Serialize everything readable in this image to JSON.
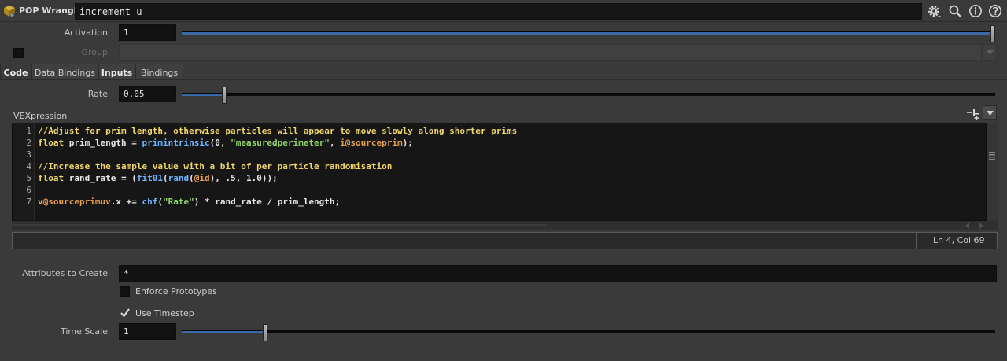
{
  "header": {
    "node_type": "POP Wrangle",
    "node_name": "increment_u",
    "icons": [
      "node-type-icon",
      "gear-icon",
      "search-icon",
      "info-icon",
      "help-icon"
    ]
  },
  "activation": {
    "label": "Activation",
    "value": "1",
    "slider_fraction": 1.0
  },
  "group": {
    "label": "Group",
    "value": ""
  },
  "tabs": [
    {
      "label": "Code"
    },
    {
      "label": "Data Bindings"
    },
    {
      "label": "Inputs"
    },
    {
      "label": "Bindings"
    }
  ],
  "rate": {
    "label": "Rate",
    "value": "0.05",
    "slider_fraction": 0.05
  },
  "vexpression": {
    "label": "VEXpression",
    "line_numbers": [
      "1",
      "2",
      "3",
      "4",
      "5",
      "6",
      "7"
    ],
    "lines": [
      "//Adjust for prim length, otherwise particles will appear to move slowly along shorter prims",
      "float prim_length = primintrinsic(0, \"measuredperimeter\", i@sourceprim);",
      "",
      "//Increase the sample value with a bit of per particle randomisation",
      "float rand_rate = (fit01(rand(@id), .5, 1.0));",
      "",
      "v@sourceprimuv.x += chf(\"Rate\") * rand_rate / prim_length;"
    ],
    "status": "Ln 4, Col 69"
  },
  "attributes": {
    "label": "Attributes to Create",
    "value": "*",
    "enforce_prototypes_label": "Enforce Prototypes",
    "enforce_prototypes_checked": false,
    "use_timestep_label": "Use Timestep",
    "use_timestep_checked": true
  },
  "time_scale": {
    "label": "Time Scale",
    "value": "1",
    "slider_fraction": 0.1
  },
  "colors": {
    "background": "#3a3a3a",
    "slider_fill": "#3c6aa8",
    "comment": "#f0d66c",
    "keyword": "#f0d66c",
    "function": "#6fb6ff",
    "string": "#8fd36a",
    "attribute": "#e8a04c"
  }
}
